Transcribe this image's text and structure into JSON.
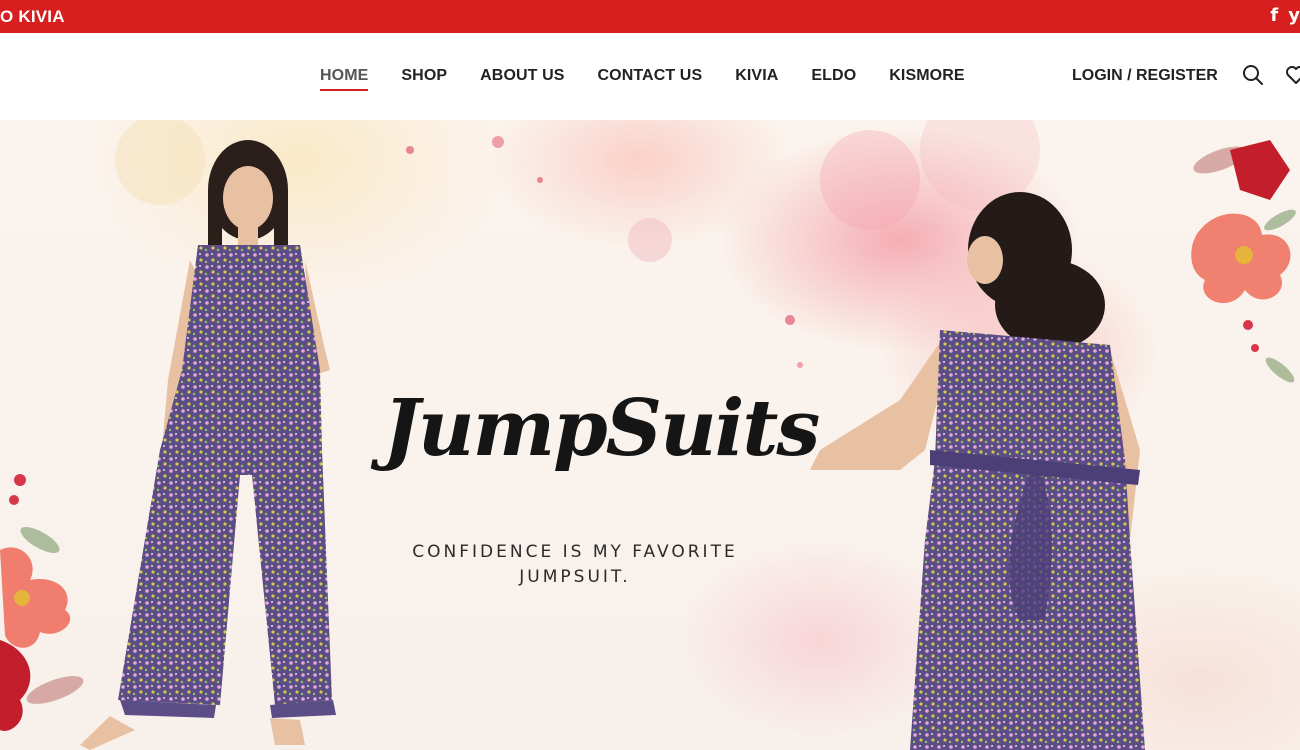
{
  "topbar": {
    "promo_text": "O KIVIA",
    "social": {
      "facebook": "f",
      "twitter": "y"
    }
  },
  "nav": {
    "items": [
      {
        "label": "HOME",
        "active": true
      },
      {
        "label": "SHOP"
      },
      {
        "label": "ABOUT US"
      },
      {
        "label": "CONTACT US"
      },
      {
        "label": "KIVIA"
      },
      {
        "label": "ELDO"
      },
      {
        "label": "KISMORE"
      }
    ],
    "login_label": "LOGIN / REGISTER",
    "icons": [
      "search-icon",
      "heart-icon"
    ]
  },
  "hero": {
    "title": "JumpSuits",
    "subtitle_line1": "CONFIDENCE IS MY FAVORITE",
    "subtitle_line2": "JUMPSUIT."
  },
  "colors": {
    "brand_red": "#d71f1f",
    "text_dark": "#222222",
    "jumpsuit_purple": "#5b4d86"
  }
}
